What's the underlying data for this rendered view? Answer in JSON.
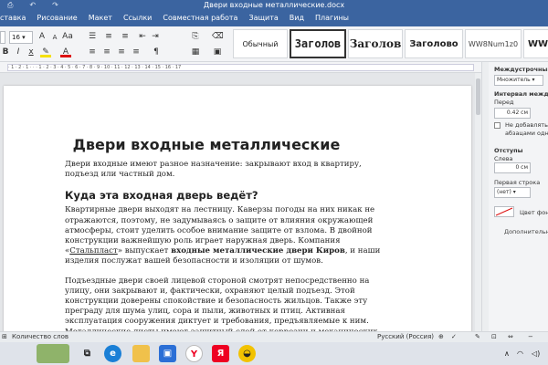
{
  "window": {
    "title": "Двери входные металлические.docx"
  },
  "menu": {
    "tabs": [
      "ставка",
      "Рисование",
      "Макет",
      "Ссылки",
      "Совместная работа",
      "Защита",
      "Вид",
      "Плагины"
    ]
  },
  "toolbar": {
    "font_size": "16",
    "styles": [
      "Обычный",
      "Заголов",
      "Заголов",
      "Заголово",
      "WW8Num1z0",
      "WW8"
    ]
  },
  "ruler": {
    "marks": "· 1 · 2 · 1 · · · 1 · 2 · 3 · 4 · 5 · 6 · 7 · 8 · 9 · 10 · 11 · 12 · 13 · 14 · 15 · 16 · 17"
  },
  "document": {
    "title": "Двери входные металлические",
    "intro": "Двери входные имеют разное назначение: закрывают вход в квартиру, подъезд или частный дом.",
    "heading2": "Куда эта входная дверь ведёт?",
    "p1_a": "Квартирные двери выходят на лестницу. Каверзы погоды на них никак не отражаются, поэтому, не задумываясь о защите от влияния окружающей атмосферы, стоит уделить особое внимание защите от взлома. В двойной конструкции важнейшую роль играет наружная дверь. Компания «",
    "p1_link": "Стальпласт",
    "p1_b": "» выпускает ",
    "p1_bold": "входные металлические двери Киров",
    "p1_c": ", и наши изделия послужат вашей безопасности и изоляции от шумов.",
    "p2": "Подъездные двери своей лицевой стороной смотрят непосредственно на улицу, они закрывают и, фактически, охраняют целый подъезд. Этой конструкции доверены спокойствие и безопасность жильцов. Также эту преграду для шума улиц, сора и пыли, животных и птиц. Активная эксплуатация сооружения диктует и требования, предъявляемые к ним. Металлические листы имеют защитный слой от коррозии и механических повреждений. Ведь перепады температур, осадки, ветра и солнце, грязь, бесчисленные открывания, прикосновения, удары – всё достаётся непосредственно этим"
  },
  "sidebar": {
    "line_spacing_title": "Междустрочный инте",
    "line_spacing_value": "Множитель",
    "para_spacing_title": "Интервал между а",
    "before_label": "Перед",
    "before_value": "0.42 см",
    "no_interval_1": "Не добавлять ин",
    "no_interval_2": "абзацами одног",
    "indents_title": "Отступы",
    "left_label": "Слева",
    "left_value": "0 см",
    "first_line_label": "Первая строка",
    "first_line_value": "(нет)",
    "bg_color_label": "Цвет фона",
    "advanced_label": "Дополнительн"
  },
  "statusbar": {
    "word_count": "Количество слов",
    "language": "Русский (Россия)"
  },
  "colors": {
    "titlebar": "#3b64a0",
    "accent": "#3b64a0"
  }
}
